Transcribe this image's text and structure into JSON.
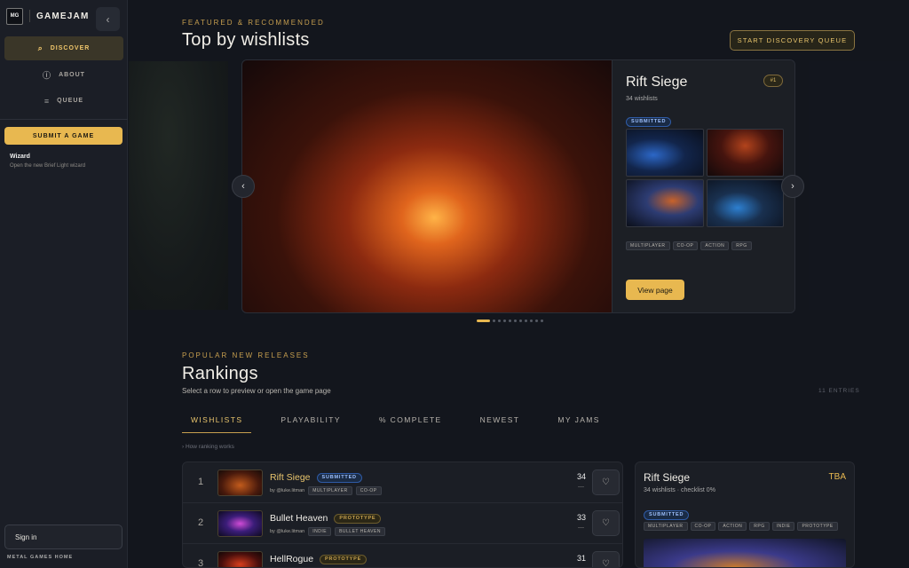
{
  "sidebar": {
    "logo_text": "MG",
    "brand": "GAMEJAM",
    "collapse_icon": "‹",
    "nav": [
      {
        "label": "DISCOVER",
        "icon": "⌕"
      },
      {
        "label": "ABOUT",
        "icon": "ⓘ"
      },
      {
        "label": "QUEUE",
        "icon": "≡"
      }
    ],
    "submit_label": "SUBMIT A GAME",
    "wizard_title": "Wizard",
    "wizard_sub": "Open the new Brief Light wizard",
    "signin_label": "Sign in",
    "footer": "METAL GAMES HOME"
  },
  "featured": {
    "eyebrow": "FEATURED & RECOMMENDED",
    "title": "Top by wishlists",
    "discovery_button": "START DISCOVERY QUEUE",
    "prev_icon": "‹",
    "next_icon": "›",
    "card": {
      "title": "Rift Siege",
      "rank": "#1",
      "wishlists": "34 wishlists",
      "status": "SUBMITTED",
      "tags": [
        "MULTIPLAYER",
        "CO-OP",
        "ACTION",
        "RPG"
      ],
      "view_label": "View page"
    },
    "dots_count": 11
  },
  "rankings": {
    "eyebrow": "POPULAR NEW RELEASES",
    "title": "Rankings",
    "subtitle": "Select a row to preview or open the game page",
    "entries": "11 ENTRIES",
    "tabs": [
      "WISHLISTS",
      "PLAYABILITY",
      "% COMPLETE",
      "NEWEST",
      "MY JAMS"
    ],
    "active_tab": 0,
    "how_link": "› How ranking works",
    "rows": [
      {
        "rank": "1",
        "name": "Rift Siege",
        "status": "SUBMITTED",
        "status_style": "blue",
        "by": "by @luke.litman",
        "tags": [
          "MULTIPLAYER",
          "CO-OP"
        ],
        "count": "34",
        "dash": "—"
      },
      {
        "rank": "2",
        "name": "Bullet Heaven",
        "status": "PROTOTYPE",
        "status_style": "gold",
        "by": "by @luke.litman",
        "tags": [
          "INDIE",
          "BULLET HEAVEN"
        ],
        "count": "33",
        "dash": "—"
      },
      {
        "rank": "3",
        "name": "HellRogue",
        "status": "PROTOTYPE",
        "status_style": "gold",
        "by": "",
        "tags": [],
        "count": "31",
        "dash": ""
      }
    ]
  },
  "preview": {
    "title": "Rift Siege",
    "tba": "TBA",
    "sub": "34 wishlists · checklist 0%",
    "status": "SUBMITTED",
    "tags": [
      "MULTIPLAYER",
      "CO-OP",
      "ACTION",
      "RPG",
      "INDIE",
      "PROTOTYPE"
    ]
  },
  "colors": {
    "accent": "#e8b850",
    "submitted": "#9ec1ff",
    "background": "#13161d"
  }
}
